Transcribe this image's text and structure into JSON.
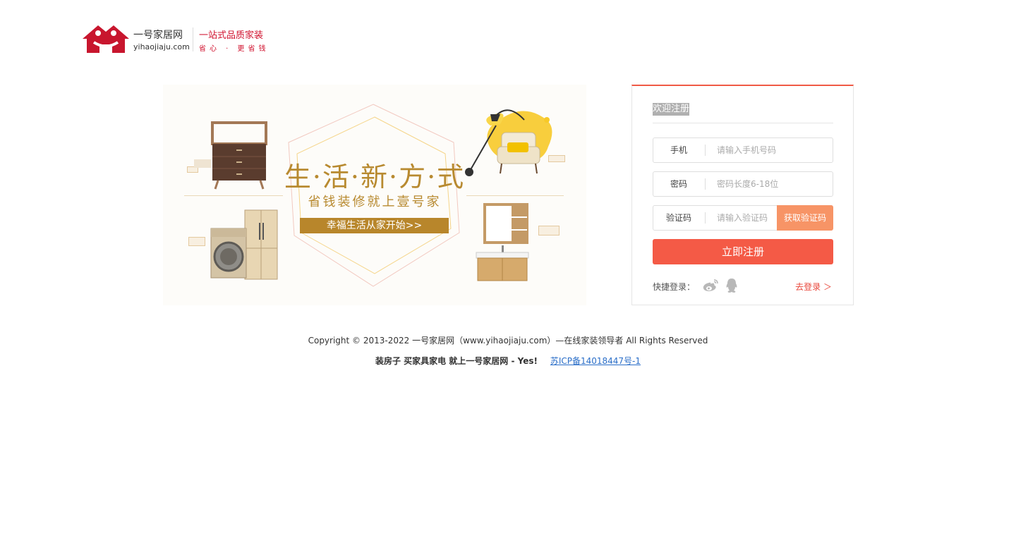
{
  "header": {
    "brand_name": "一号家居网",
    "domain": "yihaojiaju.com",
    "slogan": "一站式品质家装",
    "sub_slogan": "省心 · 更省钱"
  },
  "banner": {
    "title": "生·活·新·方·式",
    "subtitle": "省钱装修就上壹号家",
    "cta": "幸福生活从家开始>>"
  },
  "register": {
    "welcome": "欢迎注册",
    "phone_label": "手机",
    "phone_placeholder": "请输入手机号码",
    "password_label": "密码",
    "password_placeholder": "密码长度6-18位",
    "code_label": "验证码",
    "code_placeholder": "请输入验证码",
    "get_code": "获取验证码",
    "submit": "立即注册",
    "quick_login": "快捷登录：",
    "go_login": "去登录 ＞"
  },
  "footer": {
    "copyright": "Copyright © 2013-2022 一号家居网（www.yihaojiaju.com）—在线家装领导者 All Rights Reserved",
    "slogan": "装房子 买家具家电 就上一号家居网 - Yes!",
    "icp": "苏ICP备14018447号-1"
  },
  "colors": {
    "brand_red": "#d0122e",
    "accent": "#f45a46",
    "get_code": "#f79466",
    "gold": "#b88a30",
    "link": "#2a6ec8"
  }
}
